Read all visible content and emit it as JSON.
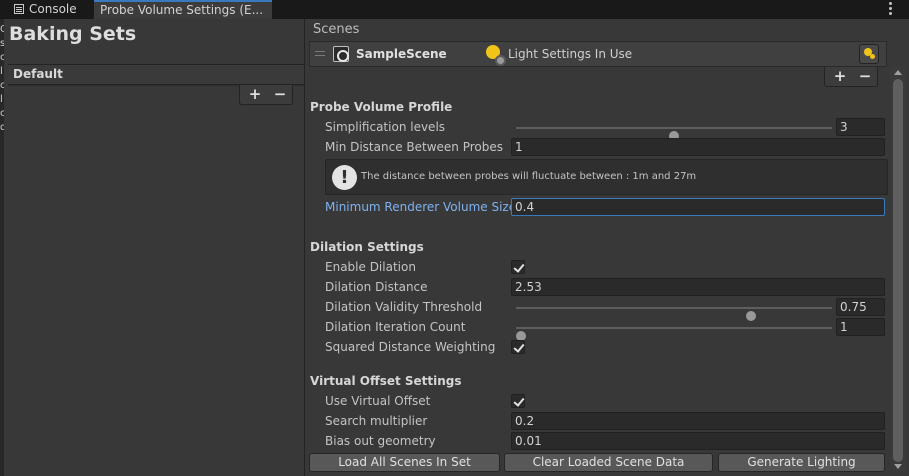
{
  "tabs": [
    {
      "label": "Console",
      "icon": "console-icon"
    },
    {
      "label": "Probe Volume Settings (E...",
      "active": true
    }
  ],
  "left_strip_chars": [
    "Q",
    "s",
    "c",
    "l",
    "c",
    "l",
    "c",
    "q"
  ],
  "baking_sets": {
    "title": "Baking Sets",
    "items": [
      "Default"
    ],
    "add_label": "+",
    "remove_label": "−"
  },
  "scenes": {
    "label": "Scenes",
    "rows": [
      {
        "name": "SampleScene",
        "light_label": "Light Settings In Use"
      }
    ],
    "add_label": "+",
    "remove_label": "−"
  },
  "probe_volume_profile": {
    "header": "Probe Volume Profile",
    "simplification_levels": {
      "label": "Simplification levels",
      "value": "3",
      "slider_fraction": 0.5
    },
    "min_distance": {
      "label": "Min Distance Between Probes",
      "value": "1"
    },
    "help_text": "The distance between probes will fluctuate between : 1m and 27m",
    "min_renderer_volume": {
      "label": "Minimum Renderer Volume Size",
      "value": "0.4"
    }
  },
  "dilation_settings": {
    "header": "Dilation Settings",
    "enable_dilation": {
      "label": "Enable Dilation",
      "checked": true
    },
    "dilation_distance": {
      "label": "Dilation Distance",
      "value": "2.53"
    },
    "validity_threshold": {
      "label": "Dilation Validity Threshold",
      "value": "0.75",
      "slider_fraction": 0.75
    },
    "iteration_count": {
      "label": "Dilation Iteration Count",
      "value": "1",
      "slider_fraction": 0.0
    },
    "squared_distance": {
      "label": "Squared Distance Weighting",
      "checked": true
    }
  },
  "virtual_offset_settings": {
    "header": "Virtual Offset Settings",
    "use_virtual_offset": {
      "label": "Use Virtual Offset",
      "checked": true
    },
    "search_multiplier": {
      "label": "Search multiplier",
      "value": "0.2"
    },
    "bias_out_geometry": {
      "label": "Bias out geometry",
      "value": "0.01"
    }
  },
  "buttons": {
    "load_all": "Load All Scenes In Set",
    "clear_loaded": "Clear Loaded Scene Data",
    "generate": "Generate Lighting"
  },
  "colors": {
    "accent": "#3a79bb",
    "focused_label": "#7fb2f0",
    "panel_bg": "#383838"
  }
}
